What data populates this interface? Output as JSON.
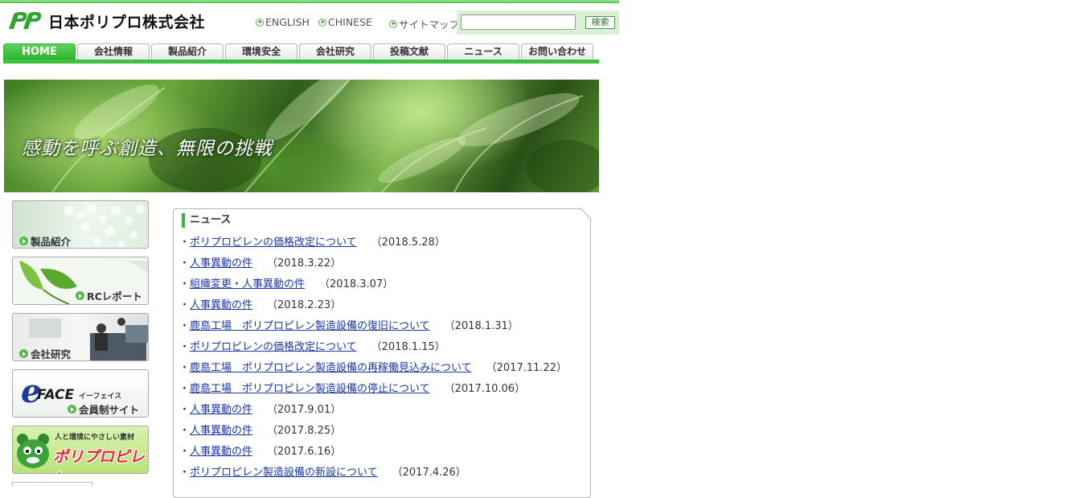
{
  "header": {
    "company_name": "日本ポリプロ株式会社",
    "links": {
      "english": "ENGLISH",
      "chinese": "CHINESE",
      "sitemap": "サイトマップ"
    },
    "search": {
      "value": "",
      "placeholder": "",
      "button_label": "検索"
    }
  },
  "nav": {
    "tabs": [
      "HOME",
      "会社情報",
      "製品紹介",
      "環境安全",
      "会社研究",
      "投稿文献",
      "ニュース",
      "お問い合わせ"
    ],
    "active": "HOME"
  },
  "banner": {
    "slogan": "感動を呼ぶ創造、無限の挑戦"
  },
  "sidebar": {
    "products": "製品紹介",
    "rc_report": "RCレポート",
    "research": "会社研究",
    "eface_logo": "FACE",
    "eface_kana": "イーフェイス",
    "eface_members": "会員制サイト",
    "pp_tagline": "人と環境にやさしい素材",
    "pp_name": "ポリプロピレン"
  },
  "news": {
    "title": "ニュース",
    "items": [
      {
        "text": "ポリプロピレンの価格改定について",
        "date": "（2018.5.28）"
      },
      {
        "text": "人事異動の件",
        "date": "（2018.3.22）"
      },
      {
        "text": "組織変更・人事異動の件",
        "date": "（2018.3.07）"
      },
      {
        "text": "人事異動の件",
        "date": "（2018.2.23）"
      },
      {
        "text": "鹿島工場　ポリプロピレン製造設備の復旧について",
        "date": "（2018.1.31）"
      },
      {
        "text": "ポリプロピレンの価格改定について",
        "date": "（2018.1.15）"
      },
      {
        "text": "鹿島工場　ポリプロピレン製造設備の再稼働見込みについて",
        "date": "（2017.11.22）"
      },
      {
        "text": "鹿島工場　ポリプロピレン製造設備の停止について",
        "date": "（2017.10.06）"
      },
      {
        "text": "人事異動の件",
        "date": "（2017.9.01）"
      },
      {
        "text": "人事異動の件",
        "date": "（2017.8.25）"
      },
      {
        "text": "人事異動の件",
        "date": "（2017.6.16）"
      },
      {
        "text": "ポリプロピレン製造設備の新設について",
        "date": "（2017.4.26）"
      }
    ]
  },
  "colors": {
    "brand_green": "#3cc23c",
    "link": "#1a35a8"
  }
}
